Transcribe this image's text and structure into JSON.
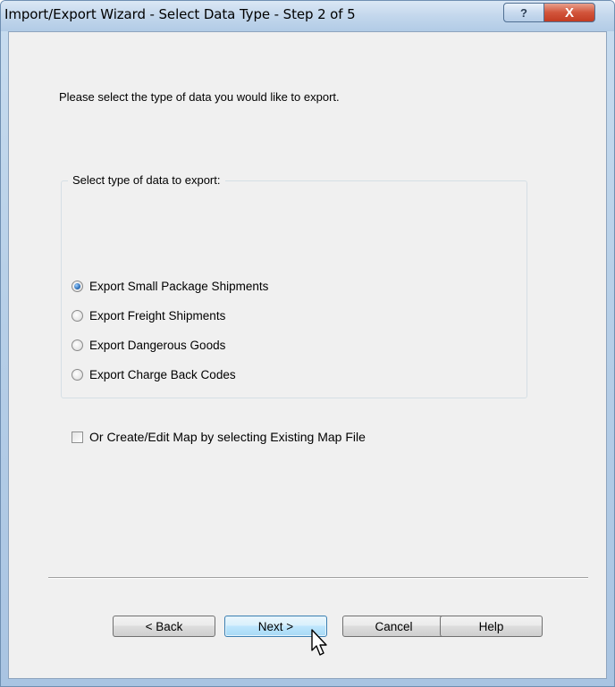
{
  "window": {
    "title": "Import/Export Wizard - Select Data Type - Step 2 of 5",
    "help_glyph": "?",
    "close_glyph": "X"
  },
  "content": {
    "instruction": "Please select the type of data you would like to export.",
    "group_title": "Select type of data to export:",
    "options": [
      {
        "label": "Export Small Package Shipments",
        "selected": true
      },
      {
        "label": "Export Freight Shipments",
        "selected": false
      },
      {
        "label": "Export Dangerous Goods",
        "selected": false
      },
      {
        "label": "Export Charge Back Codes",
        "selected": false
      }
    ],
    "map_checkbox": {
      "label": "Or Create/Edit Map by selecting Existing Map File",
      "checked": false
    }
  },
  "buttons": {
    "back": "< Back",
    "next": "Next >",
    "cancel": "Cancel",
    "help": "Help"
  },
  "colors": {
    "titlebar": "#c3d7ec",
    "close_button": "#c23b22",
    "dialog_background": "#f0f0f0",
    "default_button_border": "#3c7fb1"
  }
}
